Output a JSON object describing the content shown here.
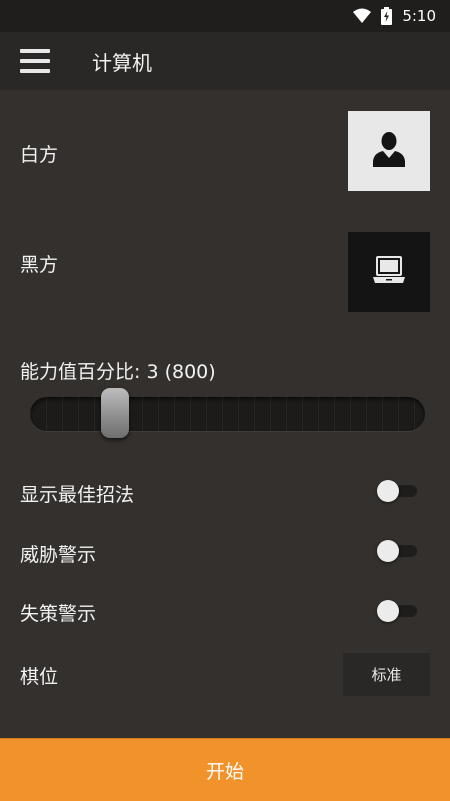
{
  "status_bar": {
    "time": "5:10",
    "icons": [
      "wifi-icon",
      "battery-charging-icon"
    ]
  },
  "app_bar": {
    "title": "计算机",
    "menu_icon": "hamburger-menu-icon"
  },
  "players": {
    "white_label": "白方",
    "white_icon": "person-icon",
    "black_label": "黑方",
    "black_icon": "laptop-icon"
  },
  "strength": {
    "label": "能力值百分比: 3 (800)",
    "value_fraction": 0.2
  },
  "options": [
    {
      "label": "显示最佳招法",
      "enabled": false
    },
    {
      "label": "威胁警示",
      "enabled": false
    },
    {
      "label": "失策警示",
      "enabled": false
    }
  ],
  "position": {
    "label": "棋位",
    "button_label": "标准"
  },
  "start_button": {
    "label": "开始"
  },
  "colors": {
    "accent": "#f2922a",
    "background": "#33302d",
    "app_bar": "#2a2826"
  }
}
